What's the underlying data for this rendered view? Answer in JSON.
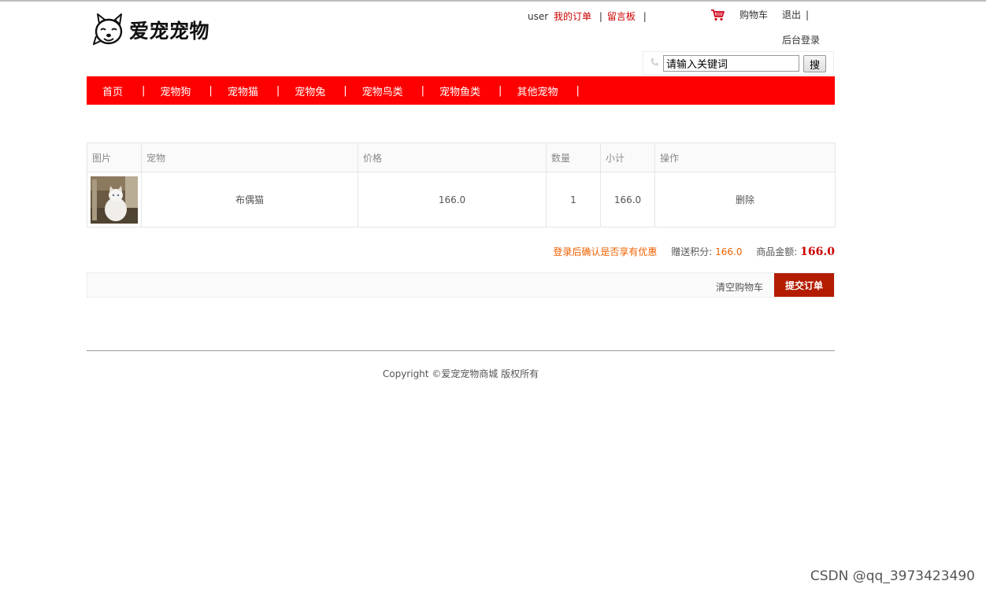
{
  "header": {
    "logo_text": "爱宠宠物",
    "user_name": "user",
    "my_orders": "我的订单",
    "message_board": "留言板",
    "cart_label": "购物车",
    "logout": "退出",
    "admin_login": "后台登录",
    "separator": "|"
  },
  "search": {
    "value": "请输入关键词",
    "button": "搜"
  },
  "nav": {
    "items": [
      "首页",
      "宠物狗",
      "宠物猫",
      "宠物兔",
      "宠物鸟类",
      "宠物鱼类",
      "其他宠物"
    ],
    "separator": "|"
  },
  "cart_table": {
    "headers": [
      "图片",
      "宠物",
      "价格",
      "数量",
      "小计",
      "操作"
    ],
    "rows": [
      {
        "pet": "布偶猫",
        "price": "166.0",
        "quantity": "1",
        "subtotal": "166.0",
        "action": "删除"
      }
    ]
  },
  "summary": {
    "login_hint": "登录后确认是否享有优惠",
    "points_label": "赠送积分:",
    "points_value": "166.0",
    "amount_label": "商品金额:",
    "amount_value": "166.0"
  },
  "actions": {
    "clear_cart": "清空购物车",
    "submit_order": "提交订单"
  },
  "footer": {
    "copyright": "Copyright ©爱宠宠物商城 版权所有"
  },
  "watermark": "CSDN @qq_3973423490",
  "colors": {
    "nav_bg": "#ff0000",
    "accent_red": "#cc0000",
    "submit_bg": "#b31c00",
    "points_orange": "#f06000"
  }
}
